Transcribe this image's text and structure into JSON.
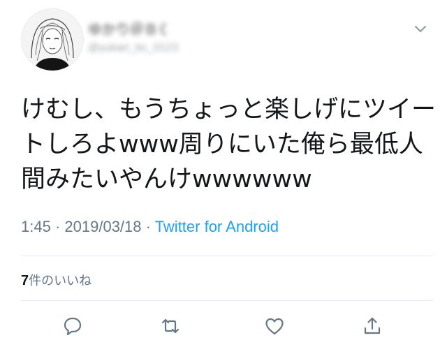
{
  "tweet": {
    "author_name": "ゆかり＠ＢＣ",
    "author_handle": "@yukari_bc_0123",
    "text": "けむし、もうちょっと楽しげにツイートしろよwww周りにいた俺ら最低人間みたいやんけwwwwww",
    "time": "1:45",
    "separator": "·",
    "date": "2019/03/18",
    "source": "Twitter for Android"
  },
  "stats": {
    "likes_count": "7",
    "likes_label": "件のいいね"
  },
  "icons": {
    "menu": "chevron-down-icon",
    "reply": "reply-icon",
    "retweet": "retweet-icon",
    "like": "heart-icon",
    "share": "share-icon"
  },
  "colors": {
    "text": "#14171a",
    "secondary": "#657786",
    "link": "#1da1f2",
    "divider": "#e6ecf0"
  }
}
